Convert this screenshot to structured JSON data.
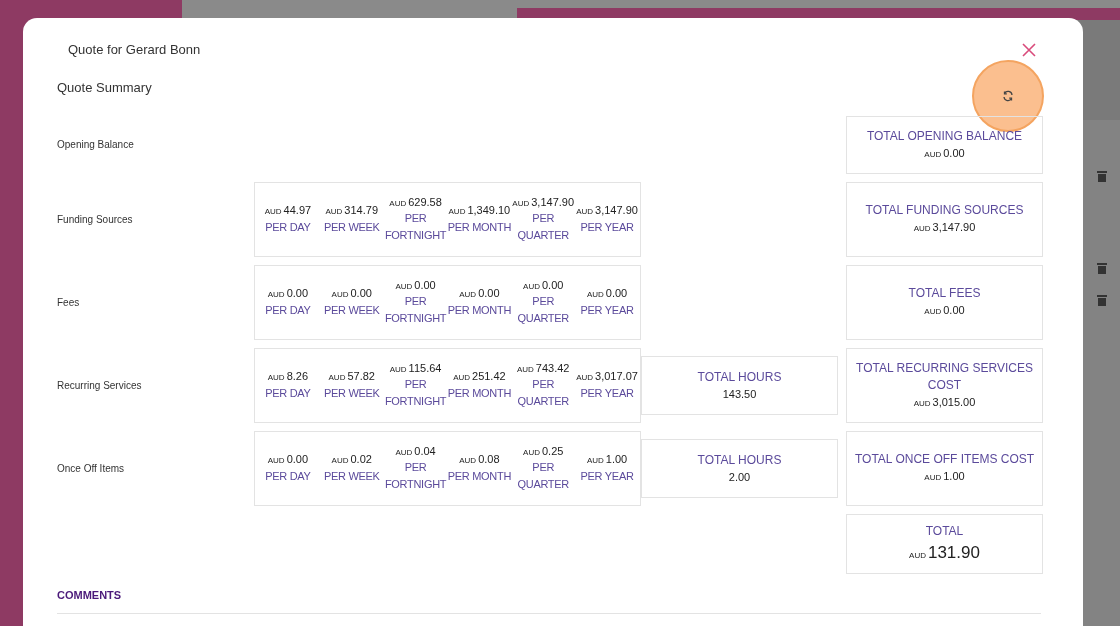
{
  "dialog": {
    "title": "Quote for Gerard Bonn",
    "heading": "Quote Summary"
  },
  "rows": [
    {
      "label": "Opening Balance",
      "total": {
        "label": "TOTAL OPENING BALANCE",
        "currency": "AUD",
        "value": "0.00"
      }
    },
    {
      "label": "Funding Sources",
      "periods": [
        {
          "currency": "AUD",
          "value": "44.97",
          "period": "PER DAY"
        },
        {
          "currency": "AUD",
          "value": "314.79",
          "period": "PER WEEK"
        },
        {
          "currency": "AUD",
          "value": "629.58",
          "period": "PER FORTNIGHT"
        },
        {
          "currency": "AUD",
          "value": "1,349.10",
          "period": "PER MONTH"
        },
        {
          "currency": "AUD",
          "value": "3,147.90",
          "period": "PER QUARTER"
        },
        {
          "currency": "AUD",
          "value": "3,147.90",
          "period": "PER YEAR"
        }
      ],
      "total": {
        "label": "TOTAL FUNDING SOURCES",
        "currency": "AUD",
        "value": "3,147.90"
      }
    },
    {
      "label": "Fees",
      "periods": [
        {
          "currency": "AUD",
          "value": "0.00",
          "period": "PER DAY"
        },
        {
          "currency": "AUD",
          "value": "0.00",
          "period": "PER WEEK"
        },
        {
          "currency": "AUD",
          "value": "0.00",
          "period": "PER FORTNIGHT"
        },
        {
          "currency": "AUD",
          "value": "0.00",
          "period": "PER MONTH"
        },
        {
          "currency": "AUD",
          "value": "0.00",
          "period": "PER QUARTER"
        },
        {
          "currency": "AUD",
          "value": "0.00",
          "period": "PER YEAR"
        }
      ],
      "total": {
        "label": "TOTAL FEES",
        "currency": "AUD",
        "value": "0.00"
      }
    },
    {
      "label": "Recurring Services",
      "periods": [
        {
          "currency": "AUD",
          "value": "8.26",
          "period": "PER DAY"
        },
        {
          "currency": "AUD",
          "value": "57.82",
          "period": "PER WEEK"
        },
        {
          "currency": "AUD",
          "value": "115.64",
          "period": "PER FORTNIGHT"
        },
        {
          "currency": "AUD",
          "value": "251.42",
          "period": "PER MONTH"
        },
        {
          "currency": "AUD",
          "value": "743.42",
          "period": "PER QUARTER"
        },
        {
          "currency": "AUD",
          "value": "3,017.07",
          "period": "PER YEAR"
        }
      ],
      "hours": {
        "label": "TOTAL HOURS",
        "value": "143.50"
      },
      "total": {
        "label": "TOTAL RECURRING SERVICES COST",
        "currency": "AUD",
        "value": "3,015.00"
      }
    },
    {
      "label": "Once Off Items",
      "periods": [
        {
          "currency": "AUD",
          "value": "0.00",
          "period": "PER DAY"
        },
        {
          "currency": "AUD",
          "value": "0.02",
          "period": "PER WEEK"
        },
        {
          "currency": "AUD",
          "value": "0.04",
          "period": "PER FORTNIGHT"
        },
        {
          "currency": "AUD",
          "value": "0.08",
          "period": "PER MONTH"
        },
        {
          "currency": "AUD",
          "value": "0.25",
          "period": "PER QUARTER"
        },
        {
          "currency": "AUD",
          "value": "1.00",
          "period": "PER YEAR"
        }
      ],
      "hours": {
        "label": "TOTAL HOURS",
        "value": "2.00"
      },
      "total": {
        "label": "TOTAL ONCE OFF ITEMS COST",
        "currency": "AUD",
        "value": "1.00"
      }
    }
  ],
  "grand_total": {
    "label": "TOTAL",
    "currency": "AUD",
    "value": "131.90"
  },
  "comments": {
    "heading": "COMMENTS"
  }
}
